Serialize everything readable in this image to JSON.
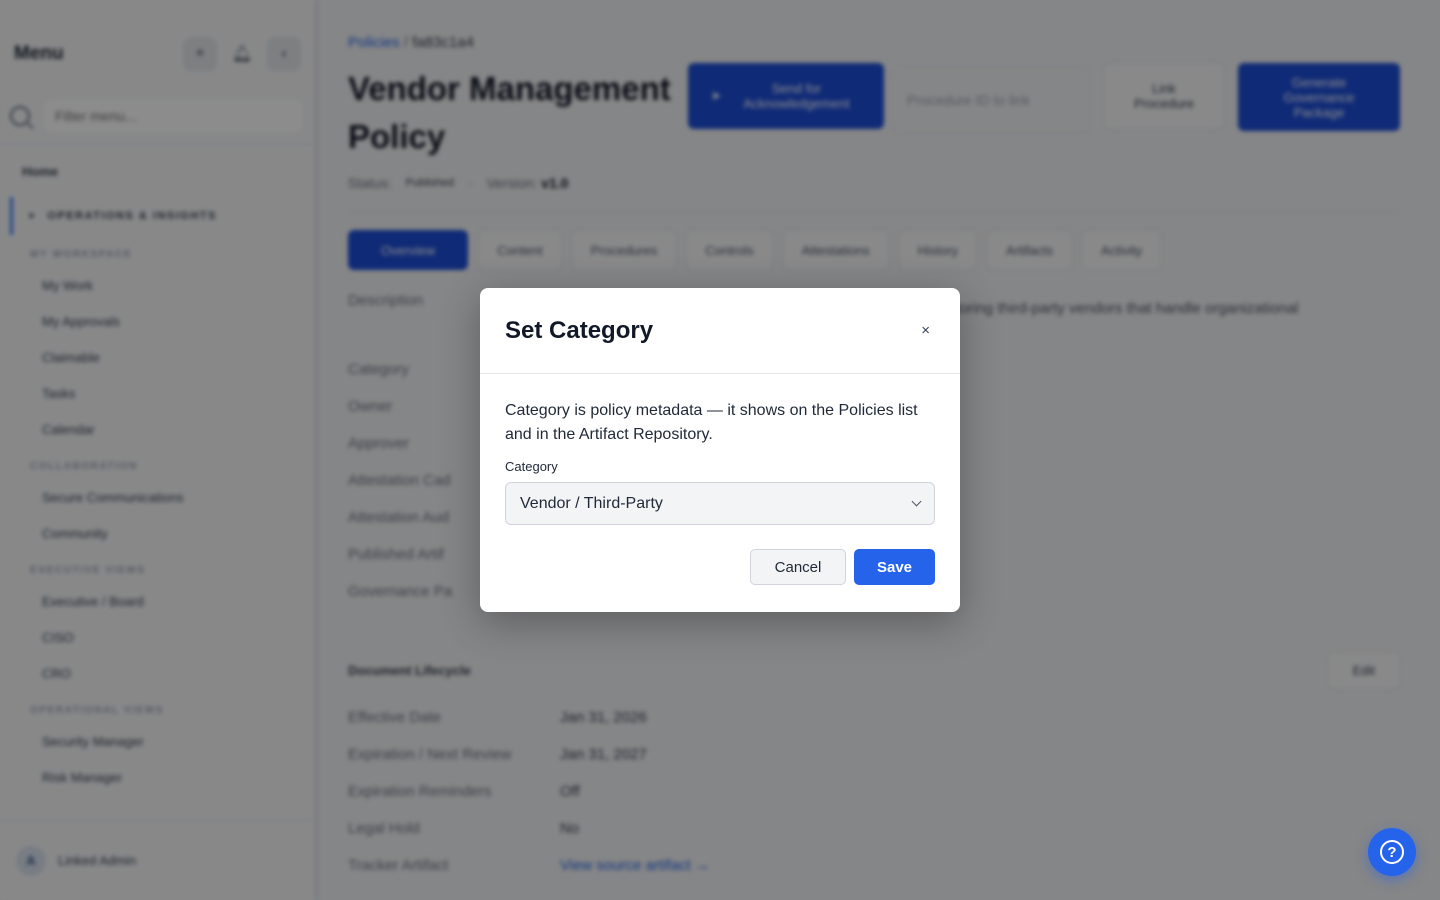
{
  "sidebar": {
    "title": "Menu",
    "add_icon": "plus-icon",
    "bell_icon": "bell-icon",
    "collapse_icon": "chevron-left-icon",
    "search_placeholder": "Filter menu...",
    "home": "Home",
    "group": "OPERATIONS & INSIGHTS",
    "sections": [
      {
        "title": "MY WORKSPACE",
        "items": [
          "My Work",
          "My Approvals",
          "Claimable",
          "Tasks",
          "Calendar"
        ]
      },
      {
        "title": "COLLABORATION",
        "items": [
          "Secure Communications",
          "Community"
        ]
      },
      {
        "title": "EXECUTIVE VIEWS",
        "items": [
          "Executive / Board",
          "CISO",
          "CRO"
        ]
      },
      {
        "title": "OPERATIONAL VIEWS",
        "items": [
          "Security Manager",
          "Risk Manager"
        ]
      }
    ],
    "user": {
      "initial": "A",
      "name": "Linked Admin"
    }
  },
  "main": {
    "breadcrumb": {
      "parent": "Policies",
      "separator": "/",
      "current": "fa83c1a4"
    },
    "title": "Vendor Management Policy",
    "actions": {
      "send": "Send for Acknowledgement",
      "procedure_placeholder": "Procedure ID to link",
      "link": "Link Procedure",
      "generate": "Generate Governance Package"
    },
    "status": {
      "label": "Status:",
      "value": "Published",
      "version_label": "Version:",
      "version": "v1.0"
    },
    "tabs": [
      "Overview",
      "Content",
      "Procedures",
      "Controls",
      "Attestations",
      "History",
      "Artifacts",
      "Activity"
    ],
    "description_label": "Description",
    "description_text": "nitoring third-party vendors that handle organizational",
    "fields": [
      "Category",
      "Owner",
      "Approver",
      "Attestation Cad",
      "Attestation Aud",
      "Published Artif",
      "Governance Pa"
    ],
    "lifecycle": {
      "title": "Document Lifecycle",
      "edit": "Edit",
      "rows": [
        {
          "label": "Effective Date",
          "value": "Jan 31, 2026"
        },
        {
          "label": "Expiration / Next Review",
          "value": "Jan 31, 2027"
        },
        {
          "label": "Expiration Reminders",
          "value": "Off"
        },
        {
          "label": "Legal Hold",
          "value": "No"
        },
        {
          "label": "Tracker Artifact",
          "value": "View source artifact →"
        }
      ]
    }
  },
  "modal": {
    "title": "Set Category",
    "close": "×",
    "description": "Category is policy metadata — it shows on the Policies list and in the Artifact Repository.",
    "field_label": "Category",
    "selected": "Vendor / Third-Party",
    "cancel": "Cancel",
    "save": "Save"
  },
  "help": {
    "icon": "question-mark-icon",
    "glyph": "?"
  },
  "colors": {
    "accent": "#2563eb",
    "primary_dark": "#1d4ed8"
  }
}
